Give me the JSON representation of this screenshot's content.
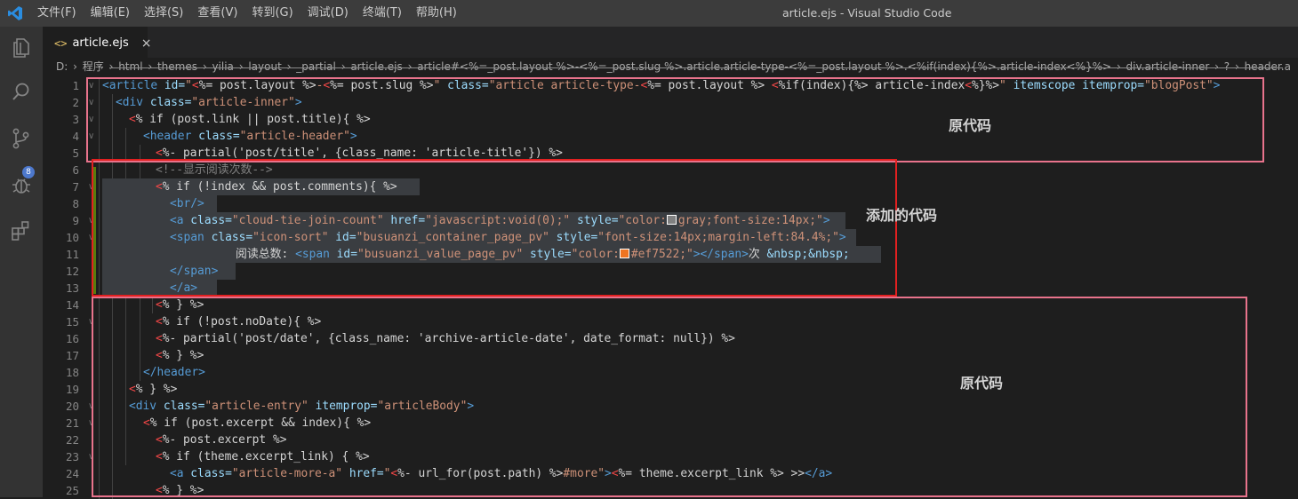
{
  "titlebar": {
    "menu": [
      "文件(F)",
      "编辑(E)",
      "选择(S)",
      "查看(V)",
      "转到(G)",
      "调试(D)",
      "终端(T)",
      "帮助(H)"
    ],
    "window_title": "article.ejs - Visual Studio Code"
  },
  "activity": {
    "scm_badge": "8"
  },
  "tab": {
    "label": "article.ejs",
    "icon_glyph": "<>",
    "close_glyph": "×"
  },
  "breadcrumb": [
    "D:",
    "程序",
    "html",
    "themes",
    "yilia",
    "layout",
    "_partial",
    "article.ejs",
    "article#<%=_post.layout %>-<%=_post.slug %>.article.article-type-<%=_post.layout %>.<%if(index){%>.article-index<%}%>",
    "div.article-inner",
    "?",
    "header.a"
  ],
  "annotations": {
    "top": "原代码",
    "middle": "添加的代码",
    "bottom": "原代码"
  },
  "colors": {
    "box_pink": "#e8738c",
    "box_red": "#e22020",
    "swatch_gray": "#808080",
    "swatch_orange": "#ef7522"
  },
  "lines": [
    {
      "n": "1",
      "segs": [
        [
          "t-tag",
          "<article "
        ],
        [
          "t-attr",
          "id="
        ],
        [
          "t-str",
          "\""
        ],
        [
          "t-red",
          "<"
        ],
        [
          "t-ejs",
          "%= post.layout %>"
        ],
        [
          "t-str",
          "-"
        ],
        [
          "t-red",
          "<"
        ],
        [
          "t-ejs",
          "%= post.slug %>"
        ],
        [
          "t-str",
          "\" "
        ],
        [
          "t-attr",
          "class="
        ],
        [
          "t-str",
          "\"article article-type-"
        ],
        [
          "t-red",
          "<"
        ],
        [
          "t-ejs",
          "%= post.layout %> "
        ],
        [
          "t-red",
          "<"
        ],
        [
          "t-ejs",
          "%if(index){%> article-index"
        ],
        [
          "t-red",
          "<"
        ],
        [
          "t-ejs",
          "%}%>"
        ],
        [
          "t-str",
          "\" "
        ],
        [
          "t-attr",
          "itemscope itemprop="
        ],
        [
          "t-str",
          "\"blogPost\""
        ],
        [
          "t-tag",
          ">"
        ]
      ]
    },
    {
      "n": "2",
      "segs": [
        [
          "t-tag",
          "<div "
        ],
        [
          "t-attr",
          "class="
        ],
        [
          "t-str",
          "\"article-inner\""
        ],
        [
          "t-tag",
          ">"
        ]
      ]
    },
    {
      "n": "3",
      "segs": [
        [
          "t-red",
          "<"
        ],
        [
          "t-ejs",
          "% if (post.link || post.title){ %>"
        ]
      ]
    },
    {
      "n": "4",
      "segs": [
        [
          "t-tag",
          "<header "
        ],
        [
          "t-attr",
          "class="
        ],
        [
          "t-str",
          "\"article-header\""
        ],
        [
          "t-tag",
          ">"
        ]
      ]
    },
    {
      "n": "5",
      "segs": [
        [
          "t-red",
          "<"
        ],
        [
          "t-ejs",
          "%- partial('post/title', {class_name: 'article-title'}) %>"
        ]
      ]
    },
    {
      "n": "6",
      "segs": [
        [
          "t-br",
          "<!--显示阅读次数-->"
        ]
      ]
    },
    {
      "n": "7",
      "segs": [
        [
          "t-red",
          "<"
        ],
        [
          "t-ejs",
          "% if (!index && post.comments){ %>"
        ]
      ]
    },
    {
      "n": "8",
      "segs": [
        [
          "t-tag",
          "<br/>"
        ]
      ]
    },
    {
      "n": "9",
      "segs": [
        [
          "t-tag",
          "<a "
        ],
        [
          "t-attr",
          "class="
        ],
        [
          "t-str",
          "\"cloud-tie-join-count\" "
        ],
        [
          "t-attr",
          "href="
        ],
        [
          "t-str",
          "\"javascript:void(0);\" "
        ],
        [
          "t-attr",
          "style="
        ],
        [
          "t-str",
          "\"color:"
        ],
        [
          "sw-gray",
          ""
        ],
        [
          "t-str",
          "gray;font-size:14px;\""
        ],
        [
          "t-tag",
          ">"
        ]
      ]
    },
    {
      "n": "10",
      "segs": [
        [
          "t-tag",
          "<span "
        ],
        [
          "t-attr",
          "class="
        ],
        [
          "t-str",
          "\"icon-sort\" "
        ],
        [
          "t-attr",
          "id="
        ],
        [
          "t-str",
          "\"busuanzi_container_page_pv\" "
        ],
        [
          "t-attr",
          "style="
        ],
        [
          "t-str",
          "\"font-size:14px;margin-left:84.4%;\""
        ],
        [
          "t-tag",
          ">"
        ]
      ]
    },
    {
      "n": "11",
      "segs": [
        [
          "t-ejs",
          "阅读总数: "
        ],
        [
          "t-tag",
          "<span "
        ],
        [
          "t-attr",
          "id="
        ],
        [
          "t-str",
          "\"busuanzi_value_page_pv\" "
        ],
        [
          "t-attr",
          "style="
        ],
        [
          "t-str",
          "\"color:"
        ],
        [
          "sw-orange",
          ""
        ],
        [
          "t-str",
          "#ef7522;\""
        ],
        [
          "t-tag",
          "></span>"
        ],
        [
          "t-ejs",
          "次 "
        ],
        [
          "t-attr",
          "&nbsp;&nbsp;"
        ]
      ]
    },
    {
      "n": "12",
      "segs": [
        [
          "t-tag",
          "</span>"
        ]
      ]
    },
    {
      "n": "13",
      "segs": [
        [
          "t-tag",
          "</a>"
        ]
      ]
    },
    {
      "n": "14",
      "segs": [
        [
          "t-red",
          "<"
        ],
        [
          "t-ejs",
          "% } %>"
        ]
      ]
    },
    {
      "n": "15",
      "segs": [
        [
          "t-red",
          "<"
        ],
        [
          "t-ejs",
          "% if (!post.noDate){ %>"
        ]
      ]
    },
    {
      "n": "16",
      "segs": [
        [
          "t-red",
          "<"
        ],
        [
          "t-ejs",
          "%- partial('post/date', {class_name: 'archive-article-date', date_format: null}) %>"
        ]
      ]
    },
    {
      "n": "17",
      "segs": [
        [
          "t-red",
          "<"
        ],
        [
          "t-ejs",
          "% } %>"
        ]
      ]
    },
    {
      "n": "18",
      "segs": [
        [
          "t-tag",
          "</header>"
        ]
      ]
    },
    {
      "n": "19",
      "segs": [
        [
          "t-red",
          "<"
        ],
        [
          "t-ejs",
          "% } %>"
        ]
      ]
    },
    {
      "n": "20",
      "segs": [
        [
          "t-tag",
          "<div "
        ],
        [
          "t-attr",
          "class="
        ],
        [
          "t-str",
          "\"article-entry\" "
        ],
        [
          "t-attr",
          "itemprop="
        ],
        [
          "t-str",
          "\"articleBody\""
        ],
        [
          "t-tag",
          ">"
        ]
      ]
    },
    {
      "n": "21",
      "segs": [
        [
          "t-red",
          "<"
        ],
        [
          "t-ejs",
          "% if (post.excerpt && index){ %>"
        ]
      ]
    },
    {
      "n": "22",
      "segs": [
        [
          "t-red",
          "<"
        ],
        [
          "t-ejs",
          "%- post.excerpt %>"
        ]
      ]
    },
    {
      "n": "23",
      "segs": [
        [
          "t-red",
          "<"
        ],
        [
          "t-ejs",
          "% if (theme.excerpt_link) { %>"
        ]
      ]
    },
    {
      "n": "24",
      "segs": [
        [
          "t-tag",
          "<a "
        ],
        [
          "t-attr",
          "class="
        ],
        [
          "t-str",
          "\"article-more-a\" "
        ],
        [
          "t-attr",
          "href="
        ],
        [
          "t-str",
          "\""
        ],
        [
          "t-red",
          "<"
        ],
        [
          "t-ejs",
          "%- url_for(post.path) %>"
        ],
        [
          "t-str",
          "#more\""
        ],
        [
          "t-tag",
          ">"
        ],
        [
          "t-red",
          "<"
        ],
        [
          "t-ejs",
          "%= theme.excerpt_link %> >>"
        ],
        [
          "t-tag",
          "</a>"
        ]
      ]
    },
    {
      "n": "25",
      "segs": [
        [
          "t-red",
          "<"
        ],
        [
          "t-ejs",
          "% } %>"
        ]
      ]
    }
  ]
}
